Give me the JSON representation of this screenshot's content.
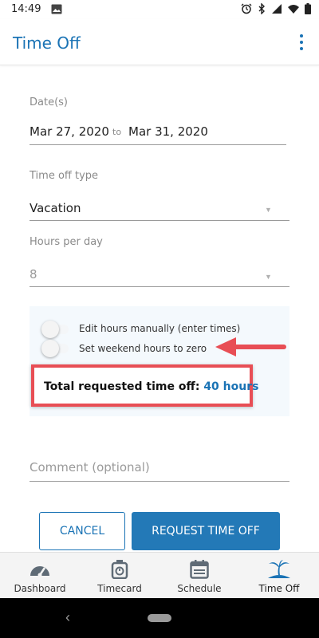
{
  "status_bar": {
    "time": "14:49",
    "left_icon": "image-icon",
    "right_icons": [
      "alarm-icon",
      "bluetooth-icon",
      "signal-icon",
      "wifi-icon",
      "battery-icon"
    ]
  },
  "app_bar": {
    "title": "Time Off",
    "menu_icon": "more-vertical-icon"
  },
  "form": {
    "dates": {
      "label": "Date(s)",
      "start": "Mar 27, 2020",
      "separator": "to",
      "end": "Mar 31, 2020"
    },
    "time_off_type": {
      "label": "Time off type",
      "value": "Vacation"
    },
    "hours_per_day": {
      "label": "Hours per day",
      "value": "8"
    },
    "toggles": [
      {
        "label": "Edit hours manually (enter times)",
        "on": false
      },
      {
        "label": "Set weekend hours to zero",
        "on": false
      }
    ],
    "total": {
      "label": "Total requested time off:",
      "value": "40 hours"
    },
    "comment": {
      "placeholder": "Comment (optional)"
    }
  },
  "actions": {
    "cancel_label": "CANCEL",
    "request_label": "REQUEST TIME OFF"
  },
  "bottom_nav": {
    "items": [
      {
        "label": "Dashboard",
        "icon": "speedometer-icon",
        "active": false
      },
      {
        "label": "Timecard",
        "icon": "stopwatch-icon",
        "active": false
      },
      {
        "label": "Schedule",
        "icon": "calendar-icon",
        "active": false
      },
      {
        "label": "Time Off",
        "icon": "palm-tree-icon",
        "active": true
      }
    ]
  },
  "colors": {
    "primary": "#1a73b5",
    "highlight_annotation": "#e84e55",
    "panel_background": "#f4f9fd"
  }
}
